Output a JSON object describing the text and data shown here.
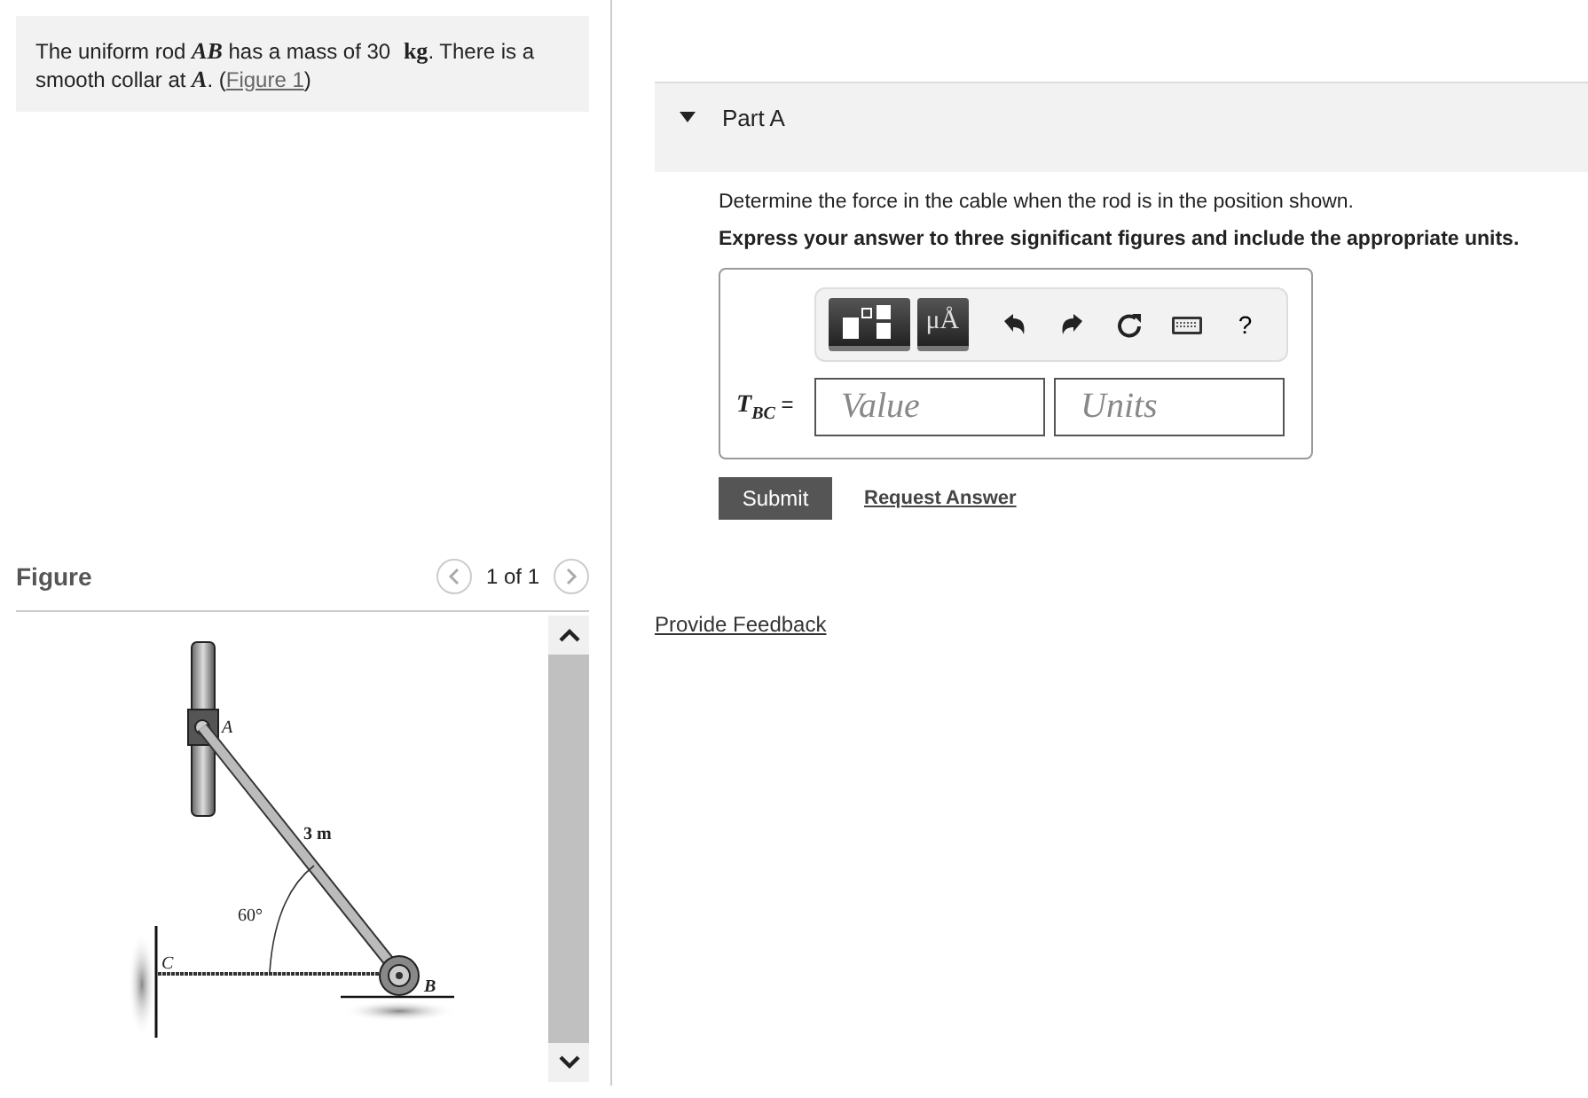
{
  "intro": {
    "text": "The uniform rod *AB* has a mass of 30 **kg**. There is a smooth collar at *A*. (",
    "link": "Figure 1",
    "text_after": ")"
  },
  "figure": {
    "title": "Figure",
    "pager": "1 of 1",
    "labels": {
      "a": "A",
      "b": "B",
      "c": "C",
      "length": "3 m",
      "angle": "60°"
    }
  },
  "part": {
    "title": "Part A",
    "expanded": true,
    "question": "Determine the force in the cable when the rod is in the position shown.",
    "instruction": "Express your answer to three significant figures and include the appropriate units.",
    "toolbar": [
      {
        "kind": "templates"
      },
      {
        "kind": "symbol",
        "label": "μÅ"
      },
      {
        "kind": "undo"
      },
      {
        "kind": "redo"
      },
      {
        "kind": "reset"
      },
      {
        "kind": "keyboard"
      },
      {
        "kind": "help",
        "label": "?"
      }
    ],
    "variable": "T",
    "subscript": "BC",
    "equals": "=",
    "value": {
      "placeholder": "Value"
    },
    "units": {
      "placeholder": "Units"
    },
    "submit": "Submit",
    "request": "Request Answer"
  },
  "feedback": "Provide Feedback"
}
